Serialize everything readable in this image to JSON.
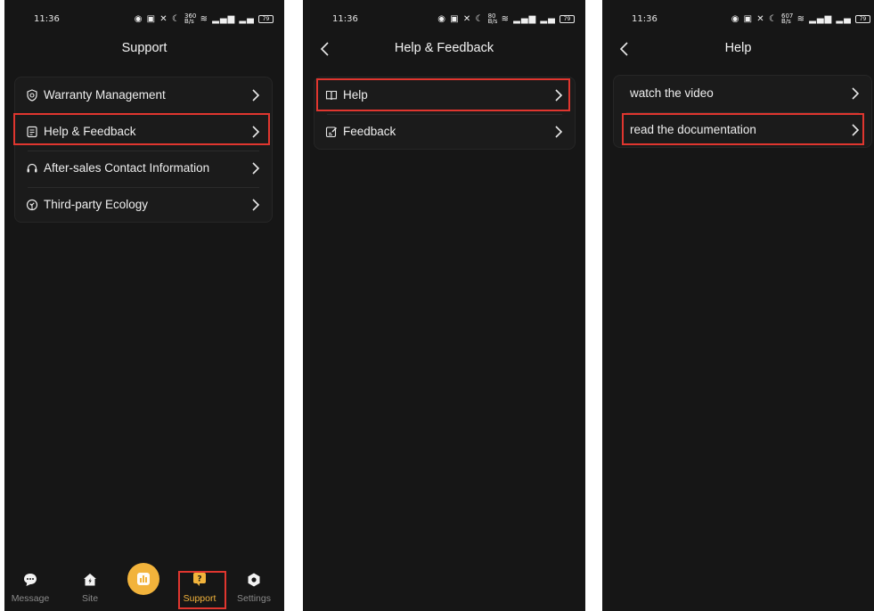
{
  "status": {
    "time": "11:36",
    "battery": "79",
    "netspeed": [
      "360",
      "80",
      "607"
    ],
    "netspeed_unit": "B/s"
  },
  "screen1": {
    "title": "Support",
    "items": [
      {
        "label": "Warranty Management",
        "icon": "shield-icon"
      },
      {
        "label": "Help & Feedback",
        "icon": "document-icon"
      },
      {
        "label": "After-sales Contact Information",
        "icon": "headset-icon"
      },
      {
        "label": "Third-party Ecology",
        "icon": "ecology-icon"
      }
    ],
    "tabs": [
      {
        "label": "Message",
        "icon": "chat-bubble-icon"
      },
      {
        "label": "Site",
        "icon": "home-bolt-icon"
      },
      {
        "label": "",
        "icon": "chart-icon"
      },
      {
        "label": "Support",
        "icon": "support-question-icon"
      },
      {
        "label": "Settings",
        "icon": "gear-icon"
      }
    ],
    "accent": "#f2b33b"
  },
  "screen2": {
    "title": "Help & Feedback",
    "items": [
      {
        "label": "Help",
        "icon": "book-icon"
      },
      {
        "label": "Feedback",
        "icon": "edit-note-icon"
      }
    ]
  },
  "screen3": {
    "title": "Help",
    "items": [
      {
        "label": "watch the video"
      },
      {
        "label": "read the documentation"
      }
    ]
  },
  "highlight_color": "#e0362f"
}
